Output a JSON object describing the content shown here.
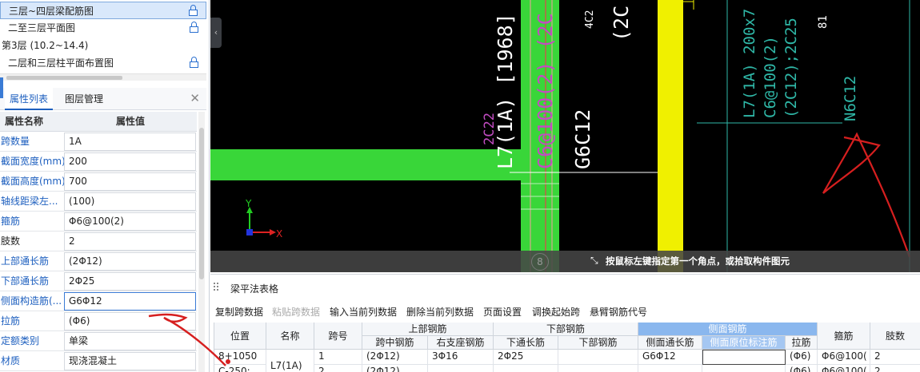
{
  "tree": {
    "items": [
      {
        "label": "三层~四层梁配筋图",
        "locked": true,
        "selected": true
      },
      {
        "label": "二至三层平面图",
        "locked": true,
        "selected": false
      },
      {
        "label": "第3层 (10.2~14.4)",
        "locked": false,
        "selected": false
      },
      {
        "label": "二层和三层柱平面布置图",
        "locked": true,
        "selected": false
      }
    ]
  },
  "props": {
    "tabs": [
      "属性列表",
      "图层管理"
    ],
    "close_icon": "✕",
    "header": {
      "name": "属性名称",
      "value": "属性值"
    },
    "rows": [
      {
        "name": "跨数量",
        "value": "1A"
      },
      {
        "name": "截面宽度(mm)",
        "value": "200"
      },
      {
        "name": "截面高度(mm)",
        "value": "700"
      },
      {
        "name": "轴线距梁左...",
        "value": "(100)"
      },
      {
        "name": "箍筋",
        "value": "Φ6@100(2)"
      },
      {
        "name": "肢数",
        "value": "2"
      },
      {
        "name": "上部通长筋",
        "value": "(2Φ12)"
      },
      {
        "name": "下部通长筋",
        "value": "2Φ25"
      },
      {
        "name": "侧面构造筋(...",
        "value": "G6Φ12"
      },
      {
        "name": "拉筋",
        "value": "(Φ6)"
      },
      {
        "name": "定额类别",
        "value": "单梁"
      },
      {
        "name": "材质",
        "value": "现浇混凝土"
      }
    ]
  },
  "canvas": {
    "labels": {
      "beam_main": "L7(1A) [1968] ,",
      "beam_magenta": "C6@100(2) (2C",
      "g6c12": "G6C12",
      "two_c22": "2C22",
      "left_paren": "(2C",
      "right_l7": "L7(1A) 200x7",
      "right_c6": "C6@100(2)",
      "right_2c12": "(2C12);2C25",
      "right_n6c12": "N6C12",
      "right_81": "81",
      "top_4": "4C2"
    },
    "axis_x": "X",
    "axis_y": "Y",
    "axis_number": "8",
    "status_text": "按鼠标左键指定第一个角点，或拾取构件图元",
    "collapse_glyph": "‹",
    "colors": {
      "background": "#000000",
      "green_beam": "#39d639",
      "yellow_column": "#f0f000",
      "cyan_text": "#2fb7a7",
      "magenta_text": "#c24cc2",
      "red_markup": "#d61f1f"
    }
  },
  "bottom": {
    "title": "梁平法表格",
    "toolbar": [
      {
        "label": "复制跨数据",
        "enabled": true
      },
      {
        "label": "粘贴跨数据",
        "enabled": false
      },
      {
        "label": "输入当前列数据",
        "enabled": true
      },
      {
        "label": "删除当前列数据",
        "enabled": true
      },
      {
        "label": "页面设置",
        "enabled": true
      },
      {
        "label": "调换起始跨",
        "enabled": true
      },
      {
        "label": "悬臂钢筋代号",
        "enabled": true
      }
    ],
    "table": {
      "group_headers": [
        "上部钢筋",
        "下部钢筋",
        "侧面钢筋"
      ],
      "headers": [
        "位置",
        "名称",
        "跨号",
        "跨中钢筋",
        "右支座钢筋",
        "下通长筋",
        "下部钢筋",
        "侧面通长筋",
        "侧面原位标注筋",
        "拉筋",
        "箍筋",
        "肢数"
      ],
      "rows": [
        [
          "8+1050",
          "L7(1A)",
          "1",
          "(2Φ12)",
          "3Φ16",
          "2Φ25",
          "",
          "G6Φ12",
          "",
          "(Φ6)",
          "Φ6@100(",
          "2"
        ],
        [
          "C-250;",
          "",
          "2",
          "(2Φ12)",
          "",
          "",
          "",
          "",
          "",
          "(Φ6)",
          "Φ6@100(",
          "2"
        ]
      ]
    }
  }
}
